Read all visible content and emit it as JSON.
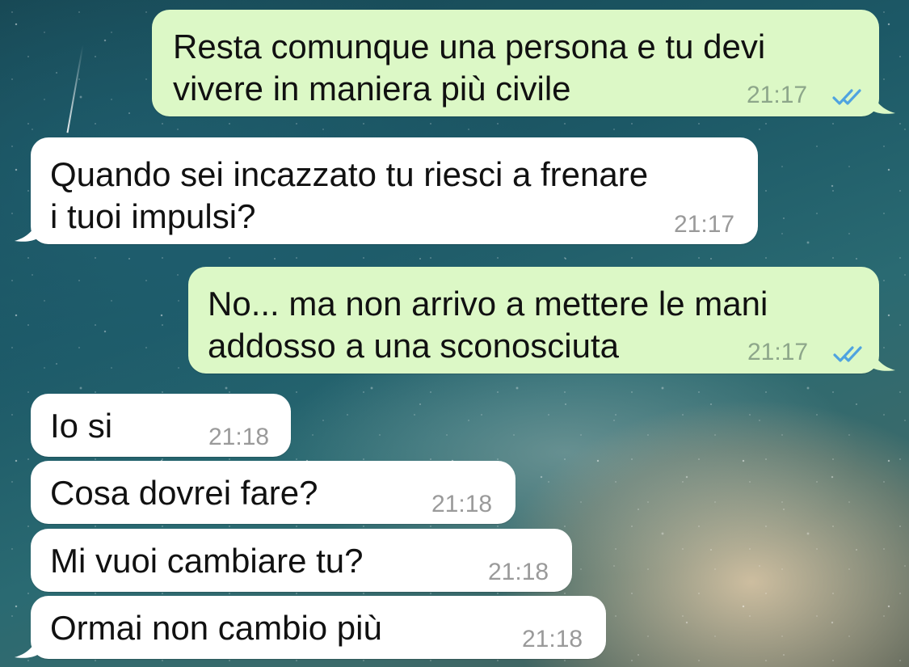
{
  "messages": [
    {
      "direction": "out",
      "text": "Resta comunque una persona e tu devi\nvivere in maniera più civile",
      "time": "21:17",
      "status": "read-ticks-icon"
    },
    {
      "direction": "in",
      "text": "Quando sei incazzato tu riesci a frenare\ni tuoi impulsi?",
      "time": "21:17"
    },
    {
      "direction": "out",
      "text": "No... ma non arrivo a mettere le mani\naddosso a una sconosciuta",
      "time": "21:17",
      "status": "read-ticks-icon"
    },
    {
      "direction": "in",
      "text": "Io si",
      "time": "21:18"
    },
    {
      "direction": "in",
      "text": "Cosa dovrei fare?",
      "time": "21:18"
    },
    {
      "direction": "in",
      "text": "Mi vuoi cambiare tu?",
      "time": "21:18"
    },
    {
      "direction": "in",
      "text": "Ormai non cambio più",
      "time": "21:18"
    }
  ],
  "colors": {
    "outgoing_bubble": "#dcf8c6",
    "incoming_bubble": "#ffffff",
    "read_ticks": "#4fa3e0",
    "timestamp": "#9a9a9a"
  }
}
